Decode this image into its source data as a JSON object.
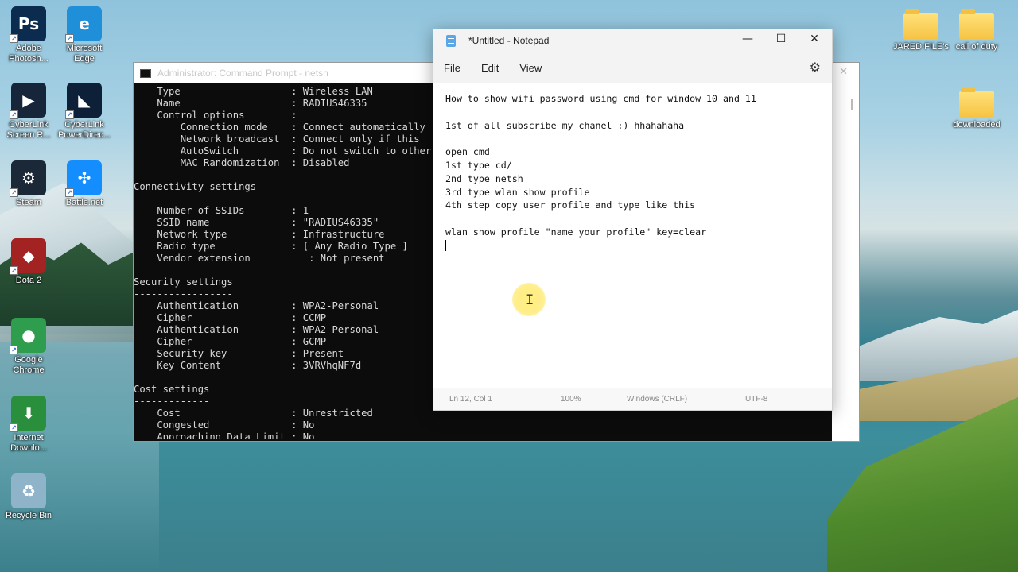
{
  "desktop": {
    "icons_left": [
      {
        "label": "Adobe\nPhotosh...",
        "glyph": "Ps",
        "color": "#0b2b4f",
        "icon": "photoshop-icon"
      },
      {
        "label": "Microsoft\nEdge",
        "glyph": "e",
        "color": "#1e8fd8",
        "icon": "edge-icon"
      },
      {
        "label": "CyberLink\nScreen R...",
        "glyph": "▶",
        "color": "#17253b",
        "icon": "screen-recorder-icon"
      },
      {
        "label": "CyberLink\nPowerDirec...",
        "glyph": "◣",
        "color": "#0e2038",
        "icon": "powerdirector-icon"
      },
      {
        "label": "Steam",
        "glyph": "⚙",
        "color": "#1b2838",
        "icon": "steam-icon"
      },
      {
        "label": "Battle.net",
        "glyph": "✣",
        "color": "#148eff",
        "icon": "battlenet-icon"
      },
      {
        "label": "Dota 2",
        "glyph": "◆",
        "color": "#a32222",
        "icon": "dota2-icon"
      },
      {
        "label": "Google\nChrome",
        "glyph": "●",
        "color": "#2e9d4d",
        "icon": "chrome-icon"
      },
      {
        "label": "Internet\nDownlo...",
        "glyph": "⬇",
        "color": "#2a8f3d",
        "icon": "internet-download-manager-icon"
      },
      {
        "label": "Recycle Bin",
        "glyph": "♻",
        "color": "#8fb3c9",
        "icon": "recycle-bin-icon"
      }
    ],
    "icons_right": [
      {
        "label": "JARED FILE's",
        "icon": "folder-icon"
      },
      {
        "label": "call of duty",
        "icon": "folder-icon"
      },
      {
        "label": "downloaded",
        "icon": "folder-icon"
      }
    ]
  },
  "cmd": {
    "title": "Administrator: Command Prompt - netsh",
    "close": "✕",
    "lines": [
      "    Type                   : Wireless LAN",
      "    Name                   : RADIUS46335",
      "    Control options        :",
      "        Connection mode    : Connect automatically",
      "        Network broadcast  : Connect only if this",
      "        AutoSwitch         : Do not switch to other",
      "        MAC Randomization  : Disabled",
      "",
      "Connectivity settings",
      "---------------------",
      "    Number of SSIDs        : 1",
      "    SSID name              : \"RADIUS46335\"",
      "    Network type           : Infrastructure",
      "    Radio type             : [ Any Radio Type ]",
      "    Vendor extension          : Not present",
      "",
      "Security settings",
      "-----------------",
      "    Authentication         : WPA2-Personal",
      "    Cipher                 : CCMP",
      "    Authentication         : WPA2-Personal",
      "    Cipher                 : GCMP",
      "    Security key           : Present",
      "    Key Content            : 3VRVhqNF7d",
      "",
      "Cost settings",
      "-------------",
      "    Cost                   : Unrestricted",
      "    Congested              : No",
      "    Approaching Data Limit : No"
    ]
  },
  "notepad": {
    "title": "*Untitled - Notepad",
    "controls": {
      "minimize": "—",
      "maximize": "☐",
      "close": "✕"
    },
    "menu": [
      "File",
      "Edit",
      "View"
    ],
    "lines": [
      "How to show wifi password using cmd for window 10 and 11",
      "",
      "1st of all subscribe my chanel :) hhahahaha",
      "",
      "open cmd",
      "1st type cd/",
      "2nd type netsh",
      "3rd type wlan show profile",
      "4th step copy user profile and type like this",
      "",
      "wlan show profile \"name your profile\" key=clear"
    ],
    "status": {
      "position": "Ln 12, Col 1",
      "zoom": "100%",
      "line_endings": "Windows (CRLF)",
      "encoding": "UTF-8"
    }
  }
}
